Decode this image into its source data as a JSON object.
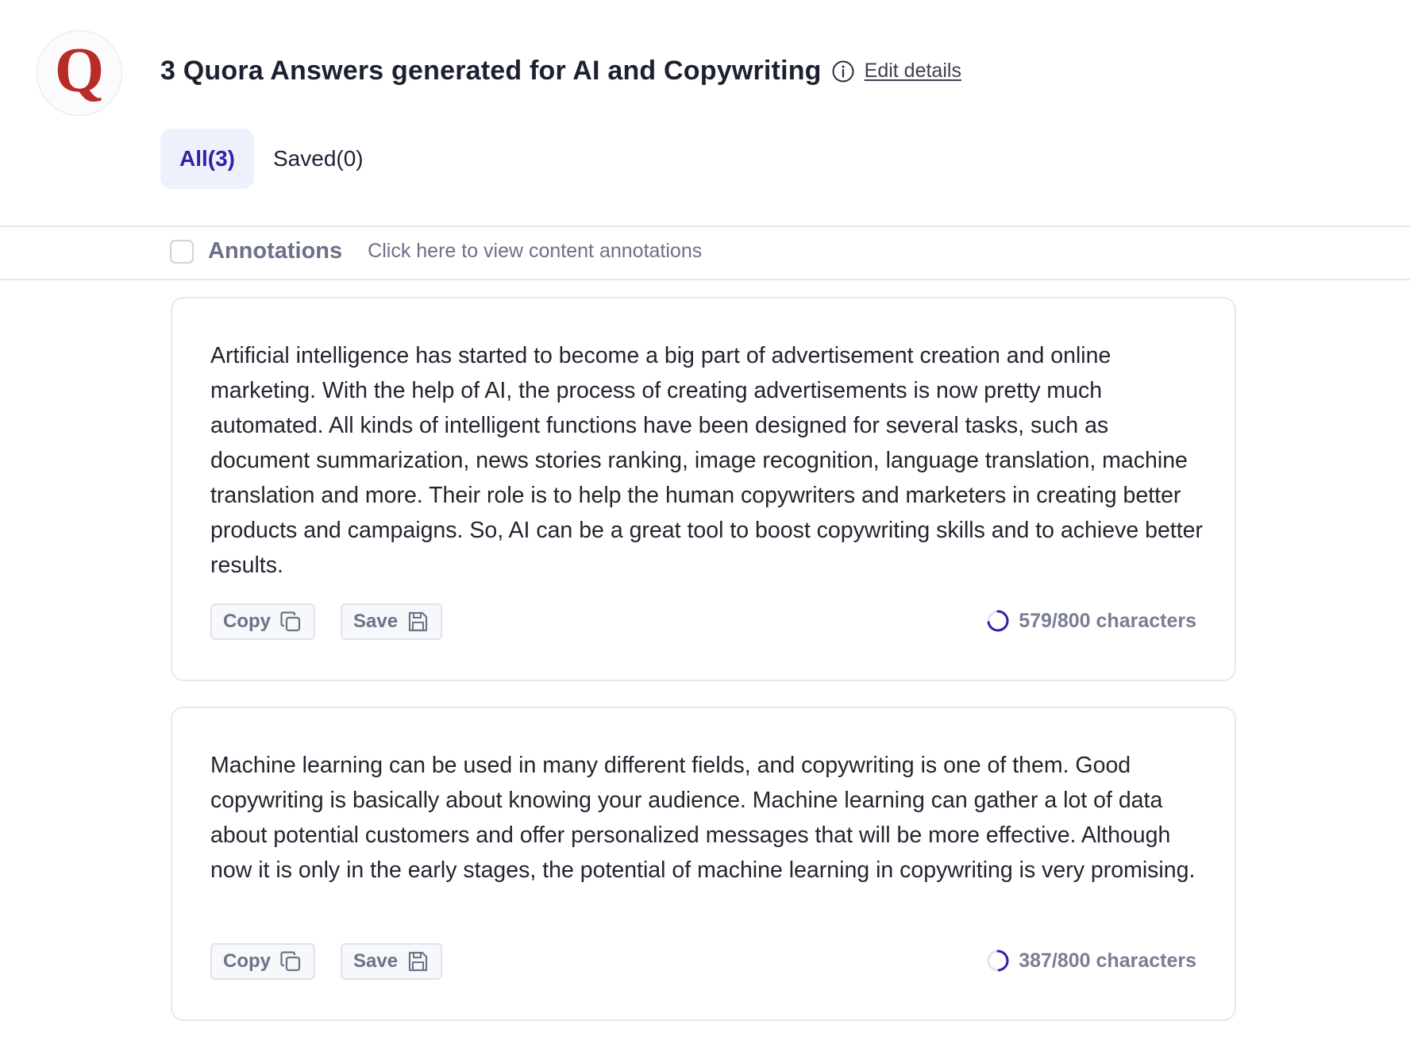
{
  "header": {
    "logo_letter": "Q",
    "title": "3 Quora Answers generated for AI and Copywriting",
    "edit_link": "Edit details"
  },
  "tabs": [
    {
      "label": "All(3)",
      "active": true
    },
    {
      "label": "Saved(0)",
      "active": false
    }
  ],
  "annotations": {
    "checked": false,
    "label": "Annotations",
    "hint": "Click here to view content annotations"
  },
  "answers": [
    {
      "text": "Artificial intelligence has started to become a big part of advertisement creation and online marketing. With the help of AI, the process of creating advertisements is now pretty much automated. All kinds of intelligent functions have been designed for several tasks, such as document summarization, news stories ranking, image recognition, language translation, machine translation and more. Their role is to help the human copywriters and marketers in creating better products and campaigns. So, AI can be a great tool to boost copywriting skills and to achieve better results.",
      "copy_label": "Copy",
      "save_label": "Save",
      "char_count": "579/800 characters",
      "progress": 0.72
    },
    {
      "text": "Machine learning can be used in many different fields, and copywriting is one of them. Good copywriting is basically about knowing your audience. Machine learning can gather a lot of data about potential customers and offer personalized messages that will be more effective. Although now it is only in the early stages, the potential of machine learning in copywriting is very promising.",
      "copy_label": "Copy",
      "save_label": "Save",
      "char_count": "387/800 characters",
      "progress": 0.48
    }
  ],
  "colors": {
    "accent": "#2e22a6",
    "quora_red": "#b92b27",
    "tab_active_bg": "#eef0fb",
    "muted_text": "#6c7089"
  }
}
